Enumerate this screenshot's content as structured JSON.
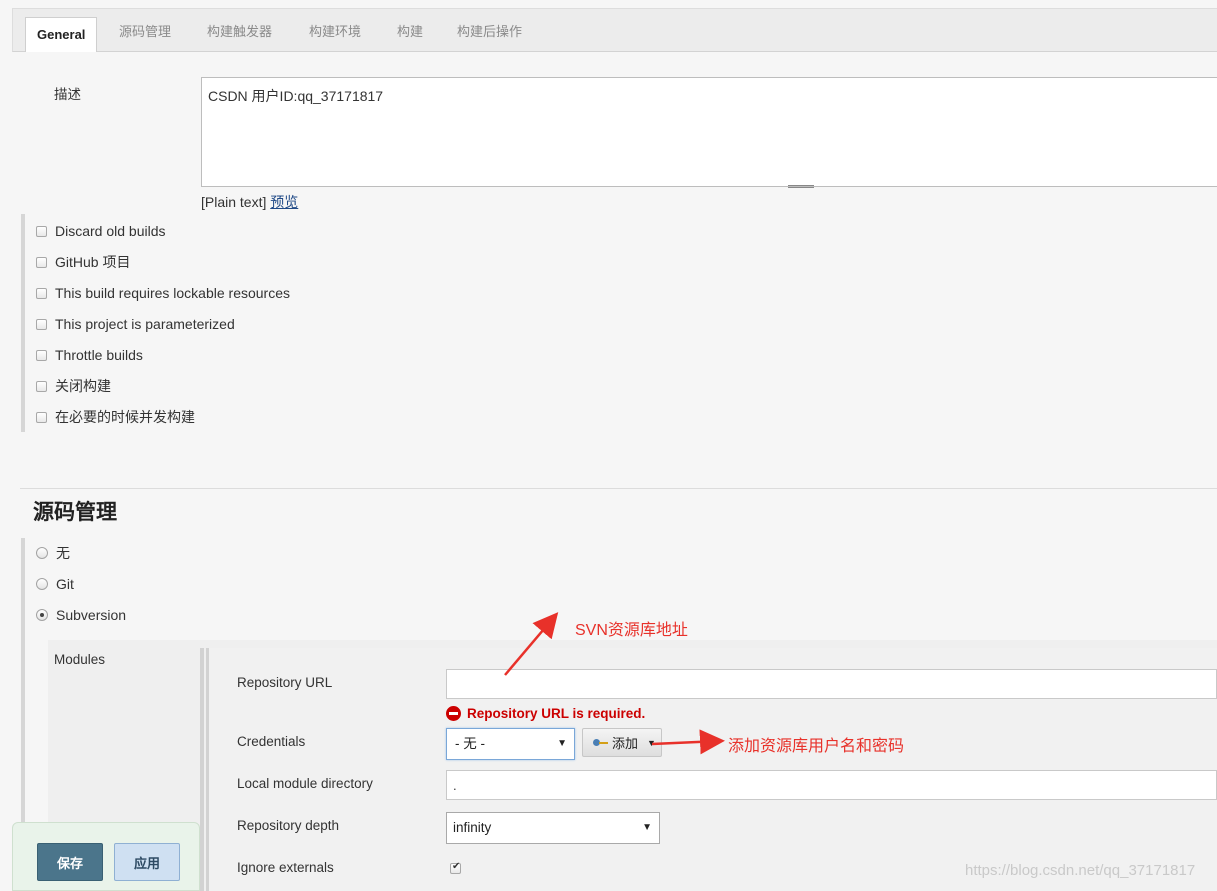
{
  "tabs": [
    {
      "label": "General"
    },
    {
      "label": "源码管理"
    },
    {
      "label": "构建触发器"
    },
    {
      "label": "构建环境"
    },
    {
      "label": "构建"
    },
    {
      "label": "构建后操作"
    }
  ],
  "description": {
    "label": "描述",
    "value": "CSDN 用户ID:qq_37171817",
    "format_text": "[Plain text]",
    "preview_link": "预览"
  },
  "options": [
    {
      "label": "Discard old builds",
      "checked": false
    },
    {
      "label": "GitHub 项目",
      "checked": false
    },
    {
      "label": "This build requires lockable resources",
      "checked": false
    },
    {
      "label": "This project is parameterized",
      "checked": false
    },
    {
      "label": "Throttle builds",
      "checked": false
    },
    {
      "label": "关闭构建",
      "checked": false
    },
    {
      "label": "在必要的时候并发构建",
      "checked": false
    }
  ],
  "scm": {
    "title": "源码管理",
    "choices": [
      {
        "label": "无",
        "selected": false
      },
      {
        "label": "Git",
        "selected": false
      },
      {
        "label": "Subversion",
        "selected": true
      }
    ],
    "modules_label": "Modules",
    "repository_url": {
      "label": "Repository URL",
      "value": ""
    },
    "error": "Repository URL is required.",
    "credentials": {
      "label": "Credentials",
      "value": "- 无 -",
      "add_label": "添加"
    },
    "local_module_directory": {
      "label": "Local module directory",
      "value": "."
    },
    "repository_depth": {
      "label": "Repository depth",
      "value": "infinity"
    },
    "ignore_externals": {
      "label": "Ignore externals",
      "checked": true
    }
  },
  "annotations": {
    "svn_url": "SVN资源库地址",
    "add_credentials": "添加资源库用户名和密码"
  },
  "actions": {
    "save": "保存",
    "apply": "应用"
  },
  "watermark": "https://blog.csdn.net/qq_37171817",
  "colors": {
    "error": "#cc0000",
    "annotation": "#e8312a",
    "save_button": "#4b758b",
    "apply_button": "#cfe0f2"
  }
}
